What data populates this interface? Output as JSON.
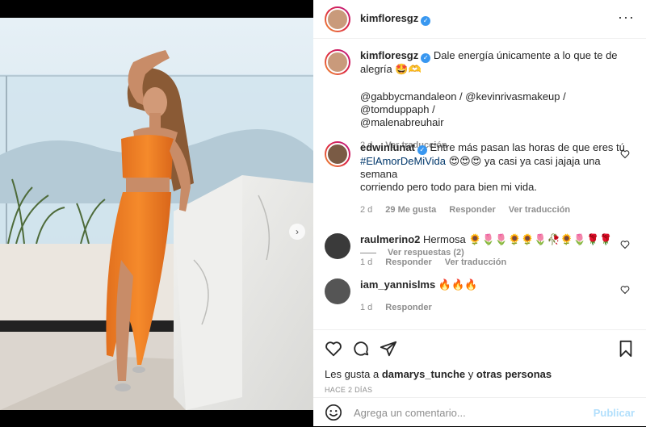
{
  "post": {
    "author": "kimfloresgz",
    "verified_mark": "✓",
    "more_glyph": "···"
  },
  "caption": {
    "username": "kimfloresgz",
    "text": "Dale energía únicamente a lo que te de alegría 🤩🫶",
    "mentions_line1": "@gabbycmandaleon / @kevinrivasmakeup / @tomduppaph /",
    "mentions_line2": "@malenabreuhair",
    "time": "2 d",
    "translate": "Ver traducción"
  },
  "comments": [
    {
      "username": "edwinlunat",
      "verified": true,
      "text_line1": "Entre más pasan las horas de que eres tú",
      "text_hashtag": "#ElAmorDeMiVida",
      "text_line2": "😍😍😍 ya casi ya casi jajaja una semana",
      "text_line3": "corriendo pero todo para bien mi vida.",
      "time": "2 d",
      "likes": "29 Me gusta",
      "reply": "Responder",
      "translate": "Ver traducción"
    },
    {
      "username": "raulmerino2",
      "text": "Hermosa 🌻🌷🌷🌻🌻🌷🥀🌻🌷🌹🌹",
      "time": "1 d",
      "reply": "Responder",
      "translate": "Ver traducción"
    },
    {
      "username": "iam_yannislms",
      "text": "🔥🔥🔥",
      "time": "1 d",
      "reply": "Responder"
    }
  ],
  "view_replies": "Ver respuestas (2)",
  "likes": {
    "prefix": "Les gusta a",
    "user": "damarys_tunche",
    "conj": "y",
    "others": "otras personas"
  },
  "timestamp": "HACE 2 DÍAS",
  "add_comment": {
    "placeholder": "Agrega un comentario...",
    "publish": "Publicar"
  },
  "icons": {
    "next": "›",
    "emoji": "smile-icon"
  },
  "colors": {
    "link": "#00376b",
    "verified": "#3897f0",
    "publish_disabled": "#b2dffc",
    "secondary_text": "#8e8e8e"
  },
  "carousel": {
    "total": 3,
    "active": 1
  }
}
